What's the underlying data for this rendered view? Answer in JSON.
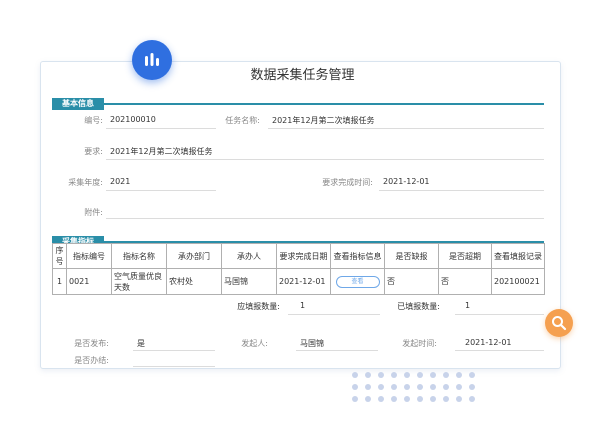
{
  "title": "数据采集任务管理",
  "sections": {
    "basic": "基本信息",
    "indicators": "采集指标"
  },
  "fields": {
    "code_label": "编号:",
    "code_value": "202100010",
    "name_label": "任务名称:",
    "name_value": "2021年12月第二次填报任务",
    "req_label": "要求:",
    "req_value": "2021年12月第二次填报任务",
    "year_label": "采集年度:",
    "year_value": "2021",
    "due_label": "要求完成时间:",
    "due_value": "2021-12-01",
    "attach_label": "附件:"
  },
  "table": {
    "headers": [
      "序号",
      "指标编号",
      "指标名称",
      "承办部门",
      "承办人",
      "要求完成日期",
      "查看指标信息",
      "是否缺报",
      "是否超期",
      "查看填报记录"
    ],
    "rows": [
      {
        "no": "1",
        "code": "0021",
        "name": "空气质量优良天数",
        "dept": "农村处",
        "person": "马国锦",
        "date": "2021-12-01",
        "view": "查看",
        "missing": "否",
        "overdue": "否",
        "record": "202100021"
      }
    ]
  },
  "counts": {
    "should_label": "应填报数量:",
    "should_value": "1",
    "done_label": "已填报数量:",
    "done_value": "1"
  },
  "footer": {
    "publish_label": "是否发布:",
    "publish_value": "是",
    "initiator_label": "发起人:",
    "initiator_value": "马国锦",
    "time_label": "发起时间:",
    "time_value": "2021-12-01",
    "finish_label": "是否办结:"
  },
  "colors": {
    "accent": "#2a8ea8",
    "brand": "#2f6fe0",
    "search": "#f5a050",
    "link": "#2f7ad8"
  },
  "icons": {
    "bubble": "bar-chart-icon",
    "floating": "search-icon"
  }
}
